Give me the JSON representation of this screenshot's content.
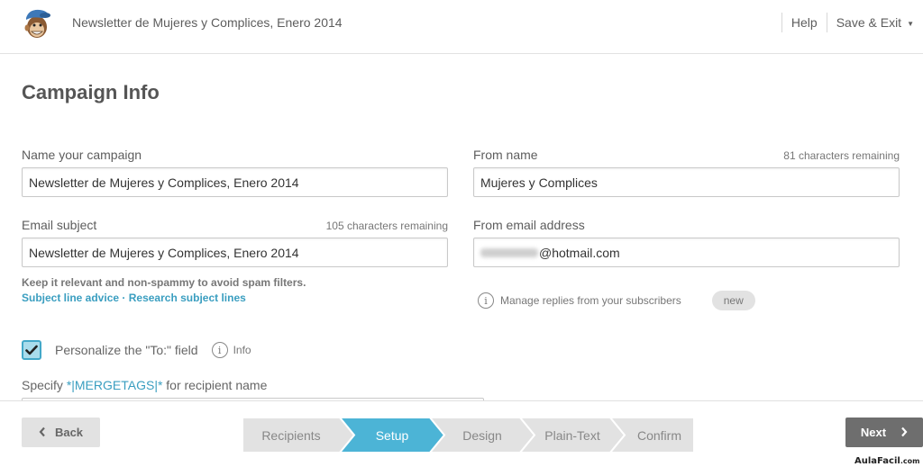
{
  "header": {
    "logo_icon": "mailchimp-freddie-logo",
    "campaign_title": "Newsletter de Mujeres y Complices, Enero 2014",
    "help_label": "Help",
    "save_exit_label": "Save & Exit",
    "save_exit_caret": "▼"
  },
  "main": {
    "page_title": "Campaign Info",
    "campaign_name": {
      "label": "Name your campaign",
      "value": "Newsletter de Mujeres y Complices, Enero 2014"
    },
    "from_name": {
      "label": "From name",
      "chars_remaining": "81 characters remaining",
      "value": "Mujeres y Complices"
    },
    "email_subject": {
      "label": "Email subject",
      "chars_remaining": "105 characters remaining",
      "value": "Newsletter de Mujeres y Complices, Enero 2014"
    },
    "from_email": {
      "label": "From email address",
      "value_visible": "@hotmail.com"
    },
    "subject_hint": {
      "text": "Keep it relevant and non-spammy to avoid spam filters.",
      "link1": "Subject line advice",
      "separator": "·",
      "link2": "Research subject lines"
    },
    "manage_replies": {
      "icon": "info-icon",
      "text": "Manage replies from your subscribers",
      "badge": "new"
    },
    "personalize": {
      "checked": true,
      "label": "Personalize the \"To:\" field",
      "info_icon": "info-icon",
      "info_label": "Info"
    },
    "specify": {
      "prefix": "Specify ",
      "tag": "*|MERGETAGS|*",
      "suffix": " for recipient name"
    }
  },
  "footer": {
    "back_label": "Back",
    "next_label": "Next",
    "steps": [
      {
        "label": "Recipients",
        "active": false
      },
      {
        "label": "Setup",
        "active": true
      },
      {
        "label": "Design",
        "active": false
      },
      {
        "label": "Plain-Text",
        "active": false
      },
      {
        "label": "Confirm",
        "active": false
      }
    ],
    "colors": {
      "step_active": "#4cb4d6",
      "step_inactive": "#e2e2e2",
      "next_button": "#6e6e6e"
    },
    "watermark": "AulaFacil",
    "watermark_suffix": ".com"
  }
}
